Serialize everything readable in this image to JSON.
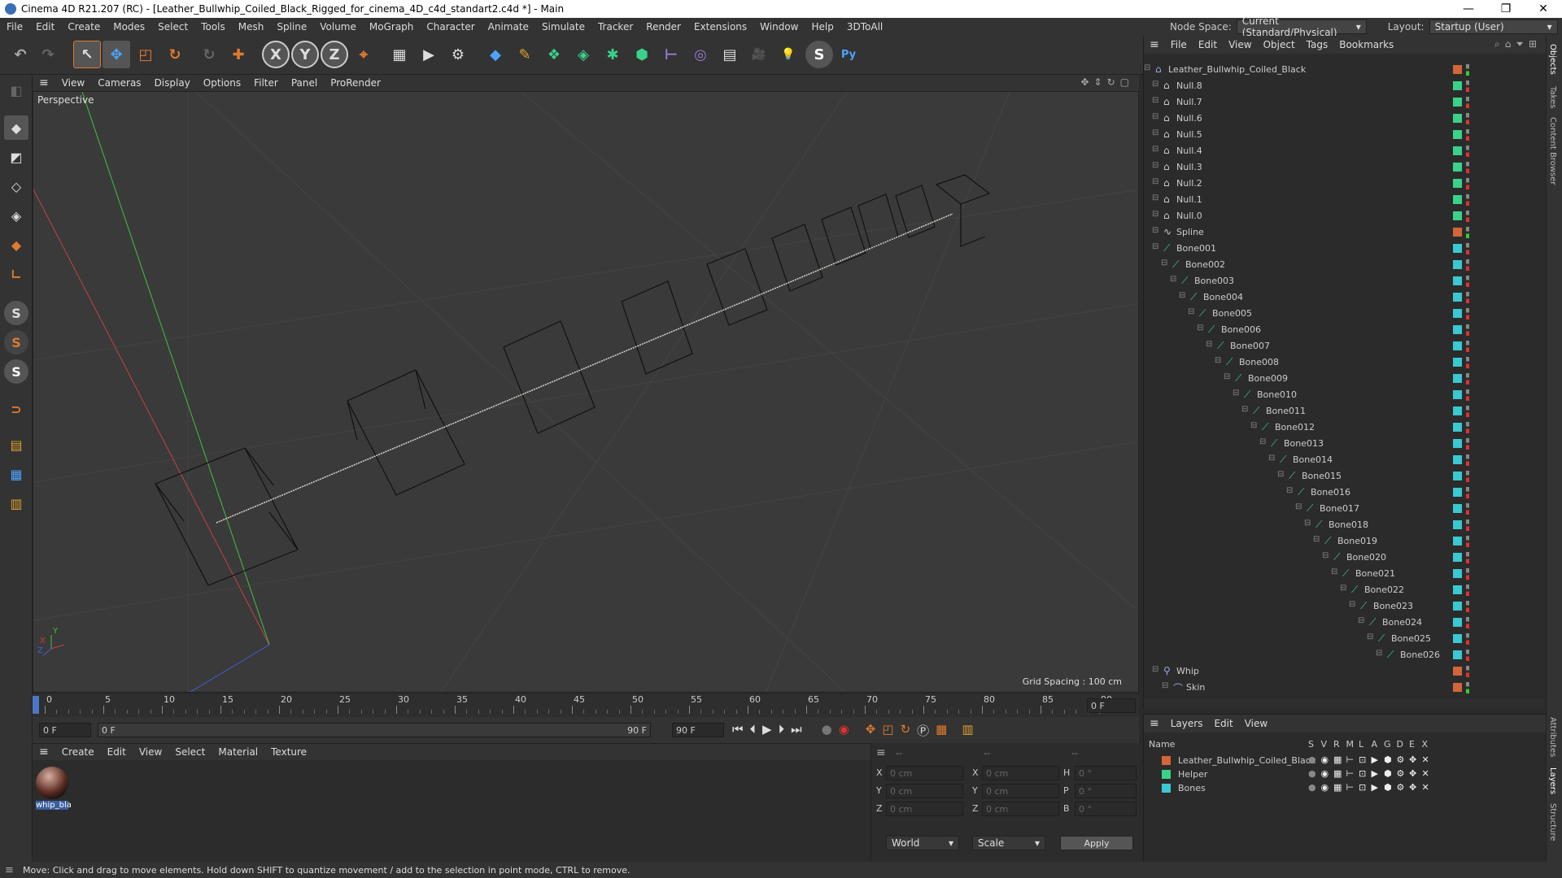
{
  "window": {
    "title": "Cinema 4D R21.207 (RC) - [Leather_Bullwhip_Coiled_Black_Rigged_for_cinema_4D_c4d_standart2.c4d *] - Main",
    "minimize": "—",
    "restore": "❐",
    "close": "✕"
  },
  "menubar": {
    "items": [
      "File",
      "Edit",
      "Create",
      "Modes",
      "Select",
      "Tools",
      "Mesh",
      "Spline",
      "Volume",
      "MoGraph",
      "Character",
      "Animate",
      "Simulate",
      "Tracker",
      "Render",
      "Extensions",
      "Window",
      "Help",
      "3DToAll"
    ],
    "node_space_label": "Node Space:",
    "node_space_value": "Current (Standard/Physical)",
    "layout_label": "Layout:",
    "layout_value": "Startup (User)"
  },
  "viewport": {
    "menu": [
      "View",
      "Cameras",
      "Display",
      "Options",
      "Filter",
      "Panel",
      "ProRender"
    ],
    "label": "Perspective",
    "grid_spacing": "Grid Spacing : 100 cm"
  },
  "timeline": {
    "ticks": [
      "0",
      "5",
      "10",
      "15",
      "20",
      "25",
      "30",
      "35",
      "40",
      "45",
      "50",
      "55",
      "60",
      "65",
      "70",
      "75",
      "80",
      "85",
      "90"
    ],
    "current_frame": "0 F"
  },
  "transport": {
    "start_field": "0 F",
    "range_start": "0 F",
    "range_end": "90 F",
    "end_field": "90 F"
  },
  "material_panel": {
    "menu": [
      "Create",
      "Edit",
      "View",
      "Select",
      "Material",
      "Texture"
    ],
    "material_name": "whip_bla"
  },
  "coord_panel": {
    "header_a": "--",
    "header_b": "--",
    "header_c": "--",
    "rows": [
      {
        "a_label": "X",
        "a_val": "0 cm",
        "b_label": "X",
        "b_val": "0 cm",
        "c_label": "H",
        "c_val": "0 °"
      },
      {
        "a_label": "Y",
        "a_val": "0 cm",
        "b_label": "Y",
        "b_val": "0 cm",
        "c_label": "P",
        "c_val": "0 °"
      },
      {
        "a_label": "Z",
        "a_val": "0 cm",
        "b_label": "Z",
        "b_val": "0 cm",
        "c_label": "B",
        "c_val": "0 °"
      }
    ],
    "world": "World",
    "scale": "Scale",
    "apply": "Apply"
  },
  "object_manager": {
    "menu": [
      "File",
      "Edit",
      "View",
      "Object",
      "Tags",
      "Bookmarks"
    ],
    "root": "Leather_Bullwhip_Coiled_Black",
    "nulls": [
      "Null.8",
      "Null.7",
      "Null.6",
      "Null.5",
      "Null.4",
      "Null.3",
      "Null.2",
      "Null.1",
      "Null.0"
    ],
    "spline": "Spline",
    "bones": [
      "Bone001",
      "Bone002",
      "Bone003",
      "Bone004",
      "Bone005",
      "Bone006",
      "Bone007",
      "Bone008",
      "Bone009",
      "Bone010",
      "Bone011",
      "Bone012",
      "Bone013",
      "Bone014",
      "Bone015",
      "Bone016",
      "Bone017",
      "Bone018",
      "Bone019",
      "Bone020",
      "Bone021",
      "Bone022",
      "Bone023",
      "Bone024",
      "Bone025",
      "Bone026"
    ],
    "whip": "Whip",
    "skin": "Skin"
  },
  "layer_manager": {
    "menu": [
      "Layers",
      "Edit",
      "View"
    ],
    "col_name": "Name",
    "cols": [
      "S",
      "V",
      "R",
      "M",
      "L",
      "A",
      "G",
      "D",
      "E",
      "X"
    ],
    "layers": [
      {
        "name": "Leather_Bullwhip_Coiled_Black",
        "color": "#d2663a"
      },
      {
        "name": "Helper",
        "color": "#3ad28a"
      },
      {
        "name": "Bones",
        "color": "#3ac8d2"
      }
    ]
  },
  "right_tabs": [
    "Objects",
    "Takes",
    "Content Browser",
    "Attributes",
    "Layers",
    "Structure"
  ],
  "status": "Move: Click and drag to move elements. Hold down SHIFT to quantize movement / add to the selection in point mode, CTRL to remove.",
  "colors": {
    "accent_orange": "#e07a2e",
    "null_tag": "#3ad28a",
    "bone_tag": "#3ac8d2",
    "root_tag": "#d2663a"
  },
  "icons": {
    "undo": "↶",
    "redo": "↷",
    "live_select": "↖",
    "move": "✥",
    "scale": "◰",
    "rotate": "↻",
    "x_axis": "X",
    "y_axis": "Y",
    "z_axis": "Z",
    "coords": "⌖",
    "render_view": "▦",
    "render": "▶",
    "render_settings": "⚙",
    "cube": "◆",
    "pen": "✎",
    "subdiv": "❖",
    "extrude": "◈",
    "cloner": "✱",
    "effector": "⬢",
    "deformer": "⊢",
    "scene": "◎",
    "floor": "▤",
    "camera": "🎥",
    "light": "💡",
    "script": "S",
    "python": "Py",
    "search": "⌕",
    "home": "⌂",
    "filter": "⏷",
    "expand": "⊞",
    "first": "⏮",
    "prev_key": "⏴",
    "play": "▶",
    "next_key": "⏵",
    "last": "⏭",
    "record": "●",
    "autokey": "◉"
  }
}
